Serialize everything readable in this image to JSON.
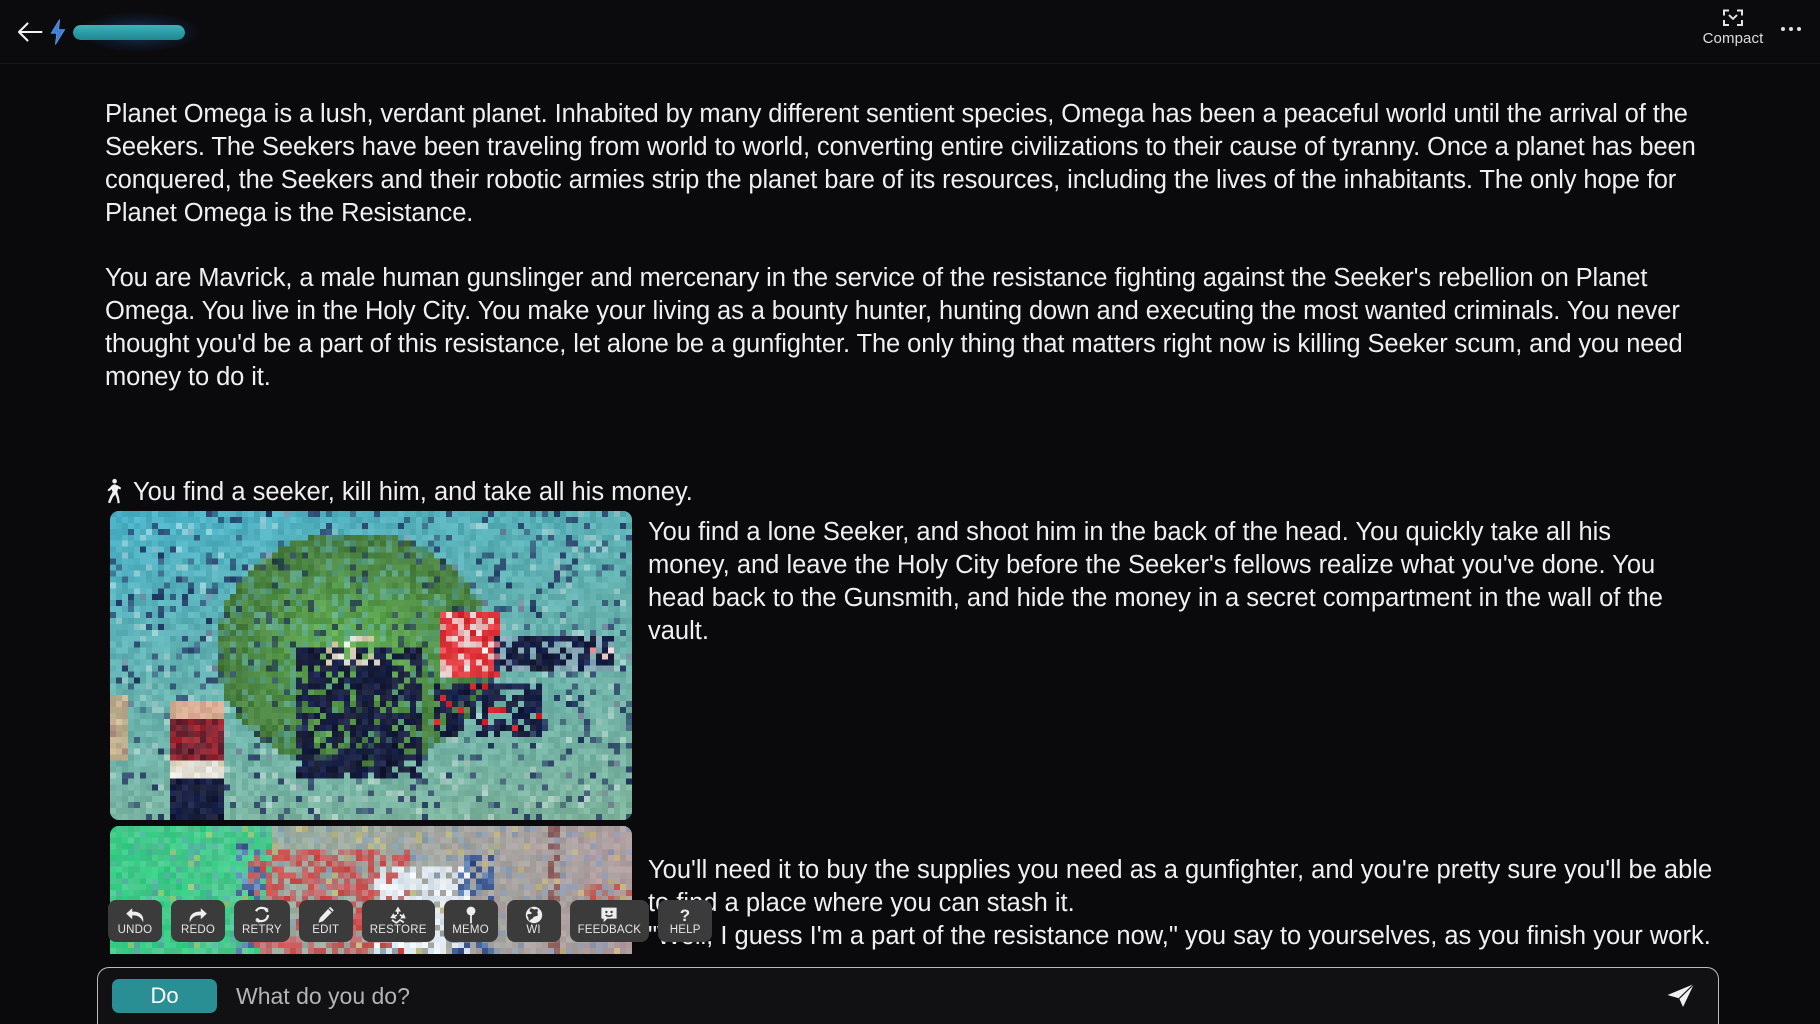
{
  "header": {
    "back_icon": "back-arrow-icon",
    "energy": {
      "bolt_icon": "lightning-bolt-icon",
      "fill_percent": 100,
      "fill_color": "#2b9aa5",
      "glow_color": "#215c96"
    },
    "compact_label": "Compact",
    "compact_icon": "collapse-icon",
    "more_icon": "more-options-icon"
  },
  "story": {
    "intro_paragraph": "Planet Omega is a lush, verdant planet. Inhabited by many different sentient species, Omega has been a peaceful world until the arrival of the Seekers. The Seekers have been traveling from world to world, converting entire civilizations to their cause of tyranny. Once a planet has been conquered, the Seekers and their robotic armies strip the planet bare of its resources, including the lives of the inhabitants. The only hope for Planet Omega is the Resistance.",
    "character_paragraph": "You are Mavrick, a male human gunslinger and mercenary in the service of the resistance fighting against the Seeker's rebellion on Planet Omega. You live in the Holy City. You make your living as a bounty hunter, hunting down and executing the most wanted criminals. You never thought you'd be a part of this resistance, let alone be a gunfighter. The only thing that matters right now is killing Seeker scum, and you need money to do it.",
    "action": {
      "icon": "running-person-icon",
      "text": "You find a seeker, kill him, and take all his money."
    },
    "result_paragraph": "You find a lone Seeker, and shoot him in the back of the head. You quickly take all his money, and leave the Holy City before the Seeker's fellows realize what you've done. You head back to the Gunsmith, and hide the money in a secret compartment in the wall of the vault.",
    "result_paragraph_two": " You'll need it to buy the supplies you need as a gunfighter, and you're pretty sure you'll be able to find a place where you can stash it.\n\"Well, I guess I'm a part of the resistance now,\" you say to yourselves, as you finish your work.",
    "images": [
      {
        "name": "story-illustration-seeker-mech",
        "alt": "Pixelated illustration of a gunslinger facing a large green mech with a red weapon"
      },
      {
        "name": "story-illustration-gunsmith-vault",
        "alt": "Pixelated illustration of a green and red scene, partially obscured"
      }
    ]
  },
  "toolbar": [
    {
      "label": "UNDO",
      "icon": "undo-arrow-icon"
    },
    {
      "label": "REDO",
      "icon": "redo-arrow-icon"
    },
    {
      "label": "RETRY",
      "icon": "refresh-icon"
    },
    {
      "label": "EDIT",
      "icon": "pencil-icon"
    },
    {
      "label": "RESTORE",
      "icon": "recycle-icon"
    },
    {
      "label": "MEMO",
      "icon": "pin-icon"
    },
    {
      "label": "WI",
      "icon": "globe-icon"
    },
    {
      "label": "FEEDBACK",
      "icon": "smiley-chat-icon"
    },
    {
      "label": "HELP",
      "icon": "question-mark-icon"
    }
  ],
  "input": {
    "mode_label": "Do",
    "mode_color": "#2a8e95",
    "placeholder": "What do you do?",
    "value": "",
    "send_icon": "send-paper-plane-icon"
  }
}
